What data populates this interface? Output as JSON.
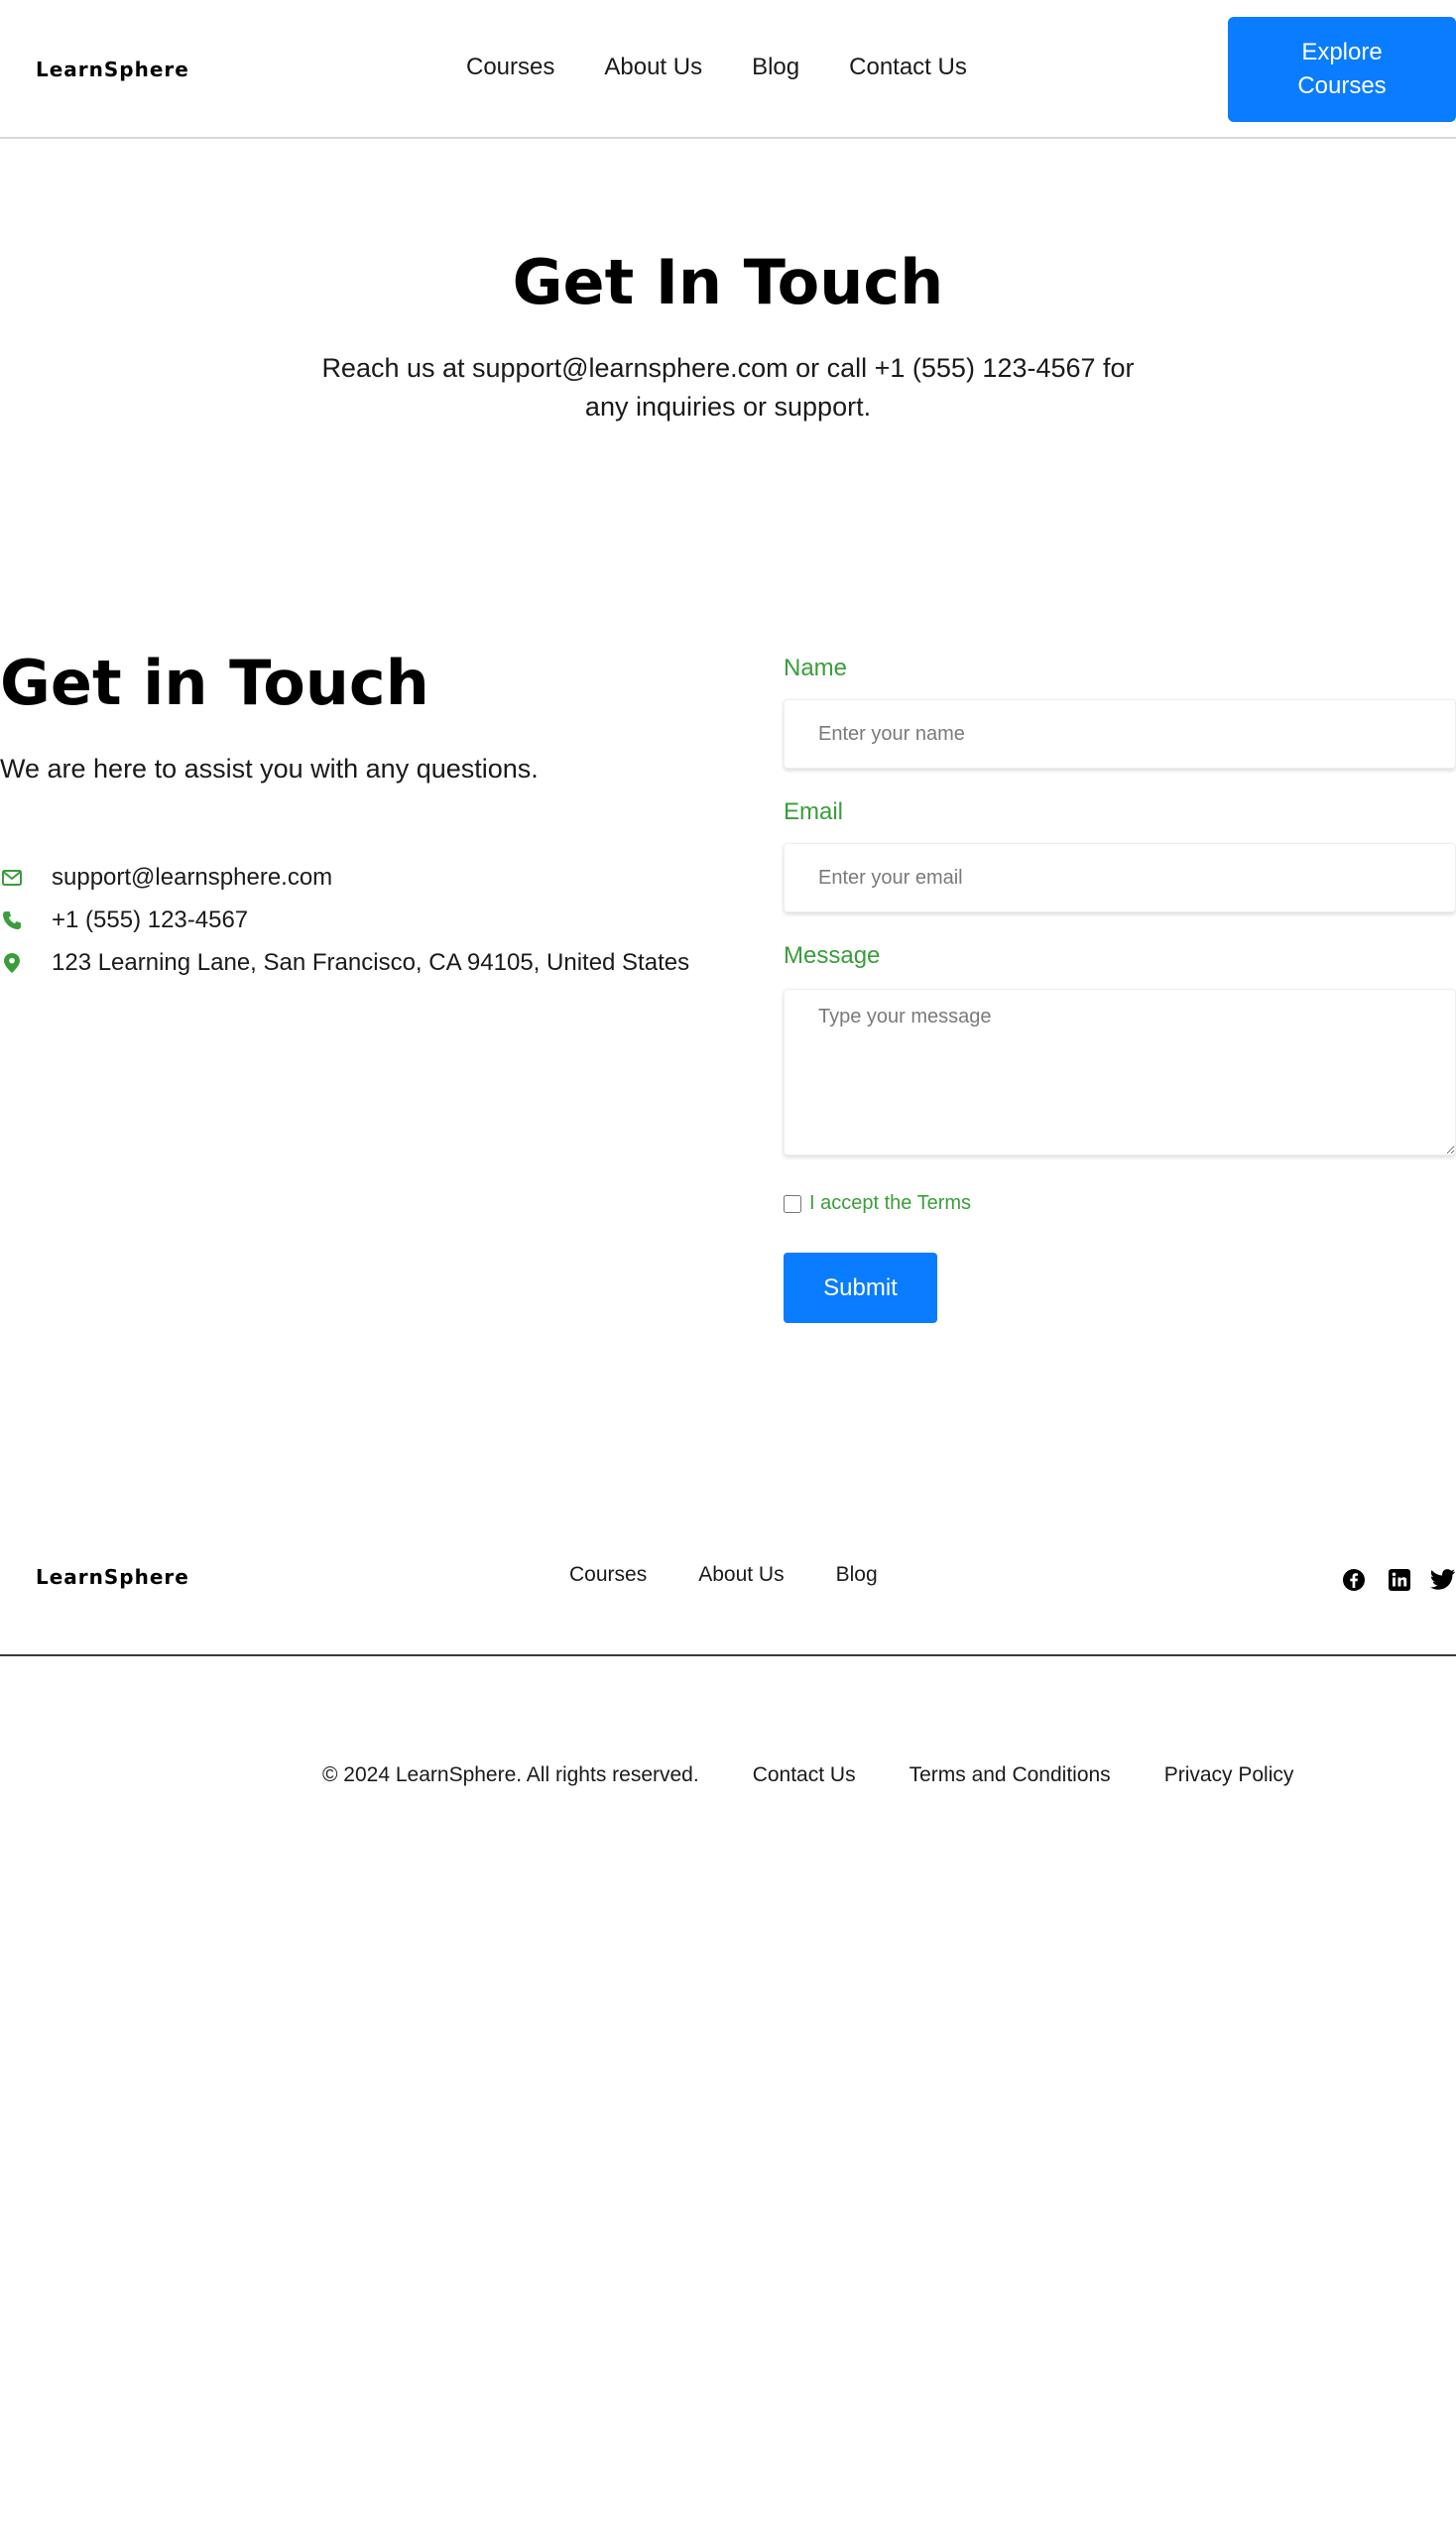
{
  "header": {
    "logo": "LearnSphere",
    "nav": [
      "Courses",
      "About Us",
      "Blog",
      "Contact Us"
    ],
    "cta": "Explore Courses"
  },
  "hero": {
    "title": "Get In Touch",
    "subtitle": "Reach us at support@learnsphere.com or call +1 (555) 123-4567 for any inquiries or support."
  },
  "contact": {
    "title": "Get in Touch",
    "subtitle": "We are here to assist you with any questions.",
    "email": "support@learnsphere.com",
    "phone": "+1 (555) 123-4567",
    "address": "123 Learning Lane, San Francisco, CA 94105, United States"
  },
  "form": {
    "name_label": "Name",
    "name_placeholder": "Enter your name",
    "email_label": "Email",
    "email_placeholder": "Enter your email",
    "message_label": "Message",
    "message_placeholder": "Type your message",
    "terms_label": "I accept the Terms",
    "submit_label": "Submit"
  },
  "footer": {
    "logo": "LearnSphere",
    "nav": [
      "Courses",
      "About Us",
      "Blog"
    ],
    "social_icons": [
      "facebook-icon",
      "linkedin-icon",
      "twitter-icon"
    ],
    "copyright": "© 2024 LearnSphere. All rights reserved.",
    "links": [
      "Contact Us",
      "Terms and Conditions",
      "Privacy Policy"
    ]
  },
  "colors": {
    "primary": "#0a7cff",
    "accent_green": "#3a9d3a",
    "text": "#1a1a1a"
  }
}
